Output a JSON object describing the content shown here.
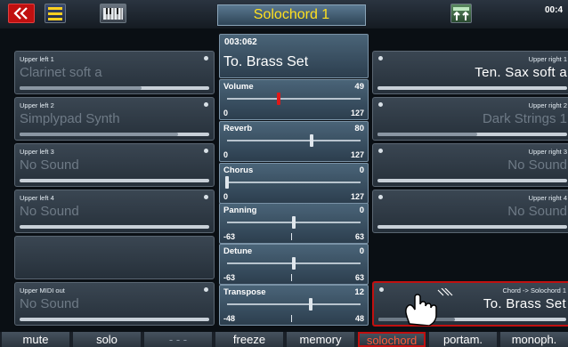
{
  "header": {
    "title": "Solochord 1",
    "clock": "00:4"
  },
  "left_panels": [
    {
      "label": "Upper left 1",
      "sound": "Clarinet soft  a"
    },
    {
      "label": "Upper left 2",
      "sound": "Simplypad Synth"
    },
    {
      "label": "Upper left 3",
      "sound": "No Sound"
    },
    {
      "label": "Upper left 4",
      "sound": "No Sound"
    },
    {
      "label": "",
      "sound": ""
    },
    {
      "label": "Upper MIDI out",
      "sound": "No Sound"
    }
  ],
  "right_panels": [
    {
      "label": "Upper right 1",
      "sound": "Ten.  Sax  soft    a"
    },
    {
      "label": "Upper right 2",
      "sound": "Dark  Strings  1"
    },
    {
      "label": "Upper right 3",
      "sound": "No  Sound"
    },
    {
      "label": "Upper right 4",
      "sound": "No  Sound"
    },
    {
      "label": "Chord  ->      Solochord  1",
      "sound": "To.  Brass  Set"
    }
  ],
  "current_sound": {
    "number": "003:062",
    "name": "To. Brass Set"
  },
  "params": [
    {
      "label": "Volume",
      "value": "49",
      "min": "0",
      "max": "127",
      "fraction": 0.386
    },
    {
      "label": "Reverb",
      "value": "80",
      "min": "0",
      "max": "127",
      "fraction": 0.63
    },
    {
      "label": "Chorus",
      "value": "0",
      "min": "0",
      "max": "127",
      "fraction": 0.0
    },
    {
      "label": "Panning",
      "value": "0",
      "min": "-63",
      "max": "63",
      "fraction": 0.5
    },
    {
      "label": "Detune",
      "value": "0",
      "min": "-63",
      "max": "63",
      "fraction": 0.5
    },
    {
      "label": "Transpose",
      "value": "12",
      "min": "-48",
      "max": "48",
      "fraction": 0.625
    }
  ],
  "bottom_buttons": [
    "mute",
    "solo",
    "- - -",
    "freeze",
    "memory",
    "solochord",
    "portam.",
    "monoph."
  ],
  "colors": {
    "accent_red": "#c01010",
    "title_text": "#ffe020",
    "volume_knob": "#e01818"
  }
}
